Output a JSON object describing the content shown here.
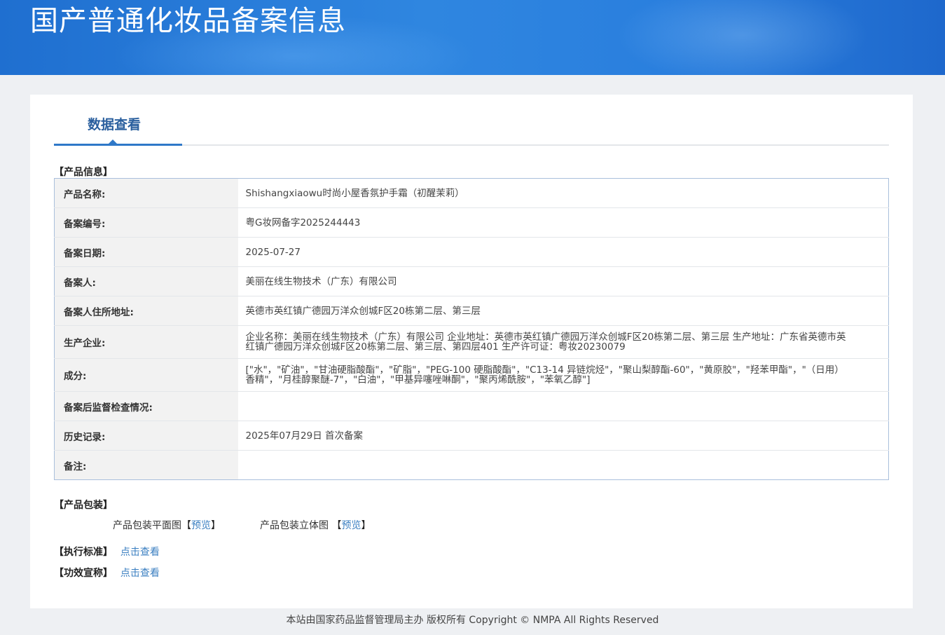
{
  "banner": {
    "title": "国产普通化妆品备案信息"
  },
  "tab": {
    "label": "数据查看"
  },
  "sections": {
    "product_info": "【产品信息】",
    "packaging": "【产品包装】",
    "standard": "【执行标准】",
    "efficacy": "【功效宣称】"
  },
  "rows": [
    {
      "label": "产品名称:",
      "value": "Shishangxiaowu时尚小屋香氛护手霜（初醒茉莉）"
    },
    {
      "label": "备案编号:",
      "value": "粤G妆网备字2025244443"
    },
    {
      "label": "备案日期:",
      "value": "2025-07-27"
    },
    {
      "label": "备案人:",
      "value": "美丽在线生物技术（广东）有限公司"
    },
    {
      "label": "备案人住所地址:",
      "value": "英德市英红镇广德园万洋众创城F区20栋第二层、第三层"
    },
    {
      "label": "生产企业:",
      "value": "企业名称：美丽在线生物技术（广东）有限公司 企业地址：英德市英红镇广德园万洋众创城F区20栋第二层、第三层 生产地址：广东省英德市英红镇广德园万洋众创城F区20栋第二层、第三层、第四层401 生产许可证：粤妆20230079"
    },
    {
      "label": "成分:",
      "value": "[\"水\"，\"矿油\"，\"甘油硬脂酸酯\"，\"矿脂\"，\"PEG-100 硬脂酸酯\"，\"C13-14 异链烷烃\"，\"聚山梨醇酯-60\"，\"黄原胶\"，\"羟苯甲酯\"，\"（日用）香精\"，\"月桂醇聚醚-7\"，\"白油\"，\"甲基异噻唑啉酮\"，\"聚丙烯酰胺\"，\"苯氧乙醇\"]"
    },
    {
      "label": "备案后监督检查情况:",
      "value": ""
    },
    {
      "label": "历史记录:",
      "value": "2025年07月29日 首次备案"
    },
    {
      "label": "备注:",
      "value": ""
    }
  ],
  "packaging": {
    "flat_label": "产品包装平面图",
    "flat_link": "预览",
    "solid_label": "产品包装立体图",
    "solid_link": "预览",
    "bracket_open": "【",
    "bracket_close": "】"
  },
  "standard_link": "点击查看",
  "efficacy_link": "点击查看",
  "footer": "本站由国家药品监督管理局主办 版权所有 Copyright © NMPA All Rights Reserved"
}
